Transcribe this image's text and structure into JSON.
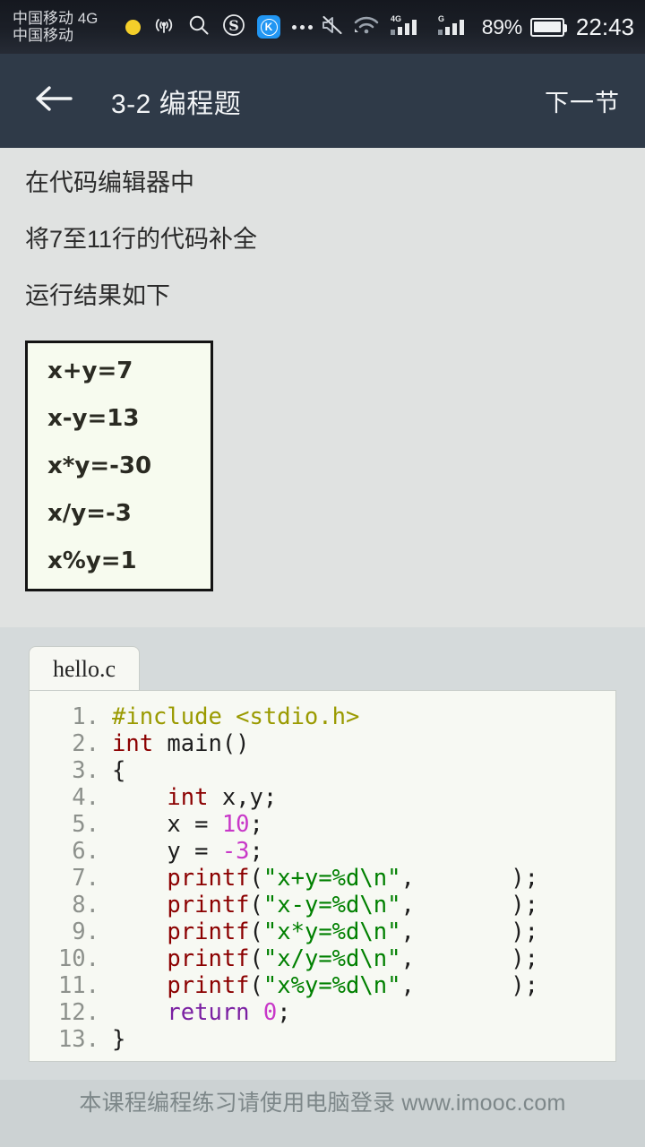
{
  "statusbar": {
    "carrier_line1": "中国移动 4G",
    "carrier_line2": "中国移动",
    "icons": [
      "yellow-dot",
      "wifi-broadcast-icon",
      "search-icon",
      "sogou-icon",
      "k-app-icon",
      "more-icon"
    ],
    "k_app_label": "K",
    "mute_icon": "mute-icon",
    "wifi_icon": "wifi-icon",
    "signal1_label": "4G",
    "signal2_label": "G",
    "battery_percent": "89%",
    "clock": "22:43"
  },
  "header": {
    "back_icon": "back-arrow-icon",
    "title": "3-2 编程题",
    "next_label": "下一节",
    "bg_color": "#2f3a48"
  },
  "instructions": [
    "在代码编辑器中",
    "将7至11行的代码补全",
    "运行结果如下"
  ],
  "output_box": {
    "lines": [
      "x+y=7",
      "x-y=13",
      "x*y=-30",
      "x/y=-3",
      "x%y=1"
    ],
    "background": "#f7fbef",
    "border_color": "#141414"
  },
  "editor": {
    "tab_label": "hello.c",
    "background": "#f7f9f3",
    "colors": {
      "preprocessor": "#9a9a00",
      "type": "#8b0000",
      "function": "#8b0000",
      "number": "#c838c8",
      "string": "#008000",
      "keyword": "#7a1fa2",
      "line_number": "#8d918c"
    },
    "lines": [
      {
        "n": "1.",
        "tokens": [
          {
            "t": "#include <stdio.h>",
            "c": "k-pre"
          }
        ]
      },
      {
        "n": "2.",
        "tokens": [
          {
            "t": "int",
            "c": "k-type"
          },
          {
            "t": " main()",
            "c": "k-pun"
          }
        ]
      },
      {
        "n": "3.",
        "tokens": [
          {
            "t": "{",
            "c": "k-pun"
          }
        ]
      },
      {
        "n": "4.",
        "tokens": [
          {
            "t": "    ",
            "c": "k-pun"
          },
          {
            "t": "int",
            "c": "k-type"
          },
          {
            "t": " x,y;",
            "c": "k-pun"
          }
        ]
      },
      {
        "n": "5.",
        "tokens": [
          {
            "t": "    x = ",
            "c": "k-pun"
          },
          {
            "t": "10",
            "c": "k-num"
          },
          {
            "t": ";",
            "c": "k-pun"
          }
        ]
      },
      {
        "n": "6.",
        "tokens": [
          {
            "t": "    y = ",
            "c": "k-pun"
          },
          {
            "t": "-3",
            "c": "k-num"
          },
          {
            "t": ";",
            "c": "k-pun"
          }
        ]
      },
      {
        "n": "7.",
        "tokens": [
          {
            "t": "    ",
            "c": "k-pun"
          },
          {
            "t": "printf",
            "c": "k-fn"
          },
          {
            "t": "(",
            "c": "k-pun"
          },
          {
            "t": "\"x+y=%d\\n\"",
            "c": "k-str"
          },
          {
            "t": ",       );",
            "c": "k-pun"
          }
        ]
      },
      {
        "n": "8.",
        "tokens": [
          {
            "t": "    ",
            "c": "k-pun"
          },
          {
            "t": "printf",
            "c": "k-fn"
          },
          {
            "t": "(",
            "c": "k-pun"
          },
          {
            "t": "\"x-y=%d\\n\"",
            "c": "k-str"
          },
          {
            "t": ",       );",
            "c": "k-pun"
          }
        ]
      },
      {
        "n": "9.",
        "tokens": [
          {
            "t": "    ",
            "c": "k-pun"
          },
          {
            "t": "printf",
            "c": "k-fn"
          },
          {
            "t": "(",
            "c": "k-pun"
          },
          {
            "t": "\"x*y=%d\\n\"",
            "c": "k-str"
          },
          {
            "t": ",       );",
            "c": "k-pun"
          }
        ]
      },
      {
        "n": "10.",
        "tokens": [
          {
            "t": "    ",
            "c": "k-pun"
          },
          {
            "t": "printf",
            "c": "k-fn"
          },
          {
            "t": "(",
            "c": "k-pun"
          },
          {
            "t": "\"x/y=%d\\n\"",
            "c": "k-str"
          },
          {
            "t": ",       );",
            "c": "k-pun"
          }
        ]
      },
      {
        "n": "11.",
        "tokens": [
          {
            "t": "    ",
            "c": "k-pun"
          },
          {
            "t": "printf",
            "c": "k-fn"
          },
          {
            "t": "(",
            "c": "k-pun"
          },
          {
            "t": "\"x%y=%d\\n\"",
            "c": "k-str"
          },
          {
            "t": ",       );",
            "c": "k-pun"
          }
        ]
      },
      {
        "n": "12.",
        "tokens": [
          {
            "t": "    ",
            "c": "k-pun"
          },
          {
            "t": "return",
            "c": "k-ret"
          },
          {
            "t": " ",
            "c": "k-pun"
          },
          {
            "t": "0",
            "c": "k-num"
          },
          {
            "t": ";",
            "c": "k-pun"
          }
        ]
      },
      {
        "n": "13.",
        "tokens": [
          {
            "t": "}",
            "c": "k-pun"
          }
        ]
      }
    ]
  },
  "footer": {
    "text": "本课程编程练习请使用电脑登录 www.imooc.com"
  }
}
